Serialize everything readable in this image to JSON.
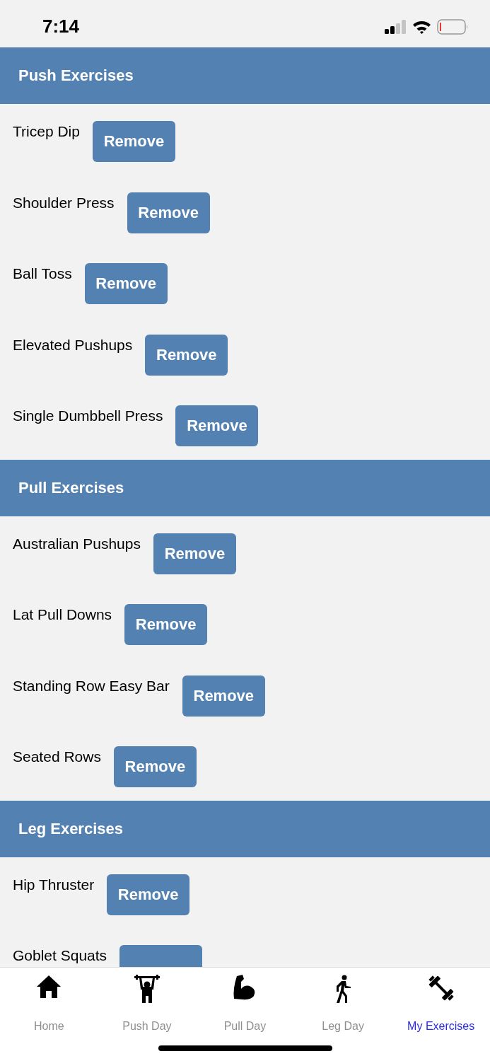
{
  "status_bar": {
    "time": "7:14"
  },
  "sections": [
    {
      "title": "Push Exercises",
      "exercises": [
        {
          "name": "Tricep Dip",
          "button": "Remove"
        },
        {
          "name": "Shoulder Press",
          "button": "Remove"
        },
        {
          "name": "Ball Toss",
          "button": "Remove"
        },
        {
          "name": "Elevated Pushups",
          "button": "Remove"
        },
        {
          "name": "Single Dumbbell Press",
          "button": "Remove"
        }
      ]
    },
    {
      "title": "Pull Exercises",
      "exercises": [
        {
          "name": "Australian Pushups",
          "button": "Remove"
        },
        {
          "name": "Lat Pull Downs",
          "button": "Remove"
        },
        {
          "name": "Standing Row Easy Bar",
          "button": "Remove"
        },
        {
          "name": "Seated Rows",
          "button": "Remove"
        }
      ]
    },
    {
      "title": "Leg Exercises",
      "exercises": [
        {
          "name": "Hip Thruster",
          "button": "Remove"
        },
        {
          "name": "Goblet Squats"
        }
      ]
    }
  ],
  "tabs": [
    {
      "kind": "home",
      "label": "Home",
      "selected": false
    },
    {
      "kind": "push",
      "label": "Push Day",
      "selected": false
    },
    {
      "kind": "pull",
      "label": "Pull Day",
      "selected": false
    },
    {
      "kind": "leg",
      "label": "Leg Day",
      "selected": false
    },
    {
      "kind": "exercises",
      "label": "My Exercises",
      "selected": true
    }
  ]
}
